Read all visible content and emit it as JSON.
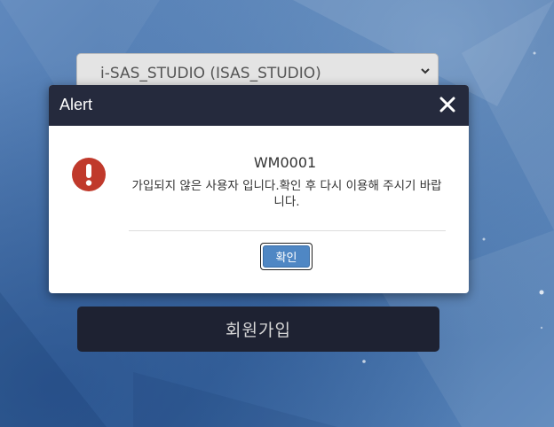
{
  "background": {
    "org_select": {
      "value": "i-SAS_STUDIO (ISAS_STUDIO)",
      "icon": "chevron-down-icon"
    },
    "signup_button_label": "회원가입"
  },
  "dialog": {
    "title": "Alert",
    "close_icon": "close-icon",
    "alert_icon": "exclamation-circle-icon",
    "message_code": "WM0001",
    "message_text": "가입되지 않은 사용자 입니다.확인 후 다시 이용해 주시기 바랍니다.",
    "confirm_label": "확인"
  },
  "colors": {
    "header": "#252a3d",
    "alert_icon": "#c0392b",
    "confirm_button": "#4f87c4",
    "signup_button": "#1e2232"
  }
}
